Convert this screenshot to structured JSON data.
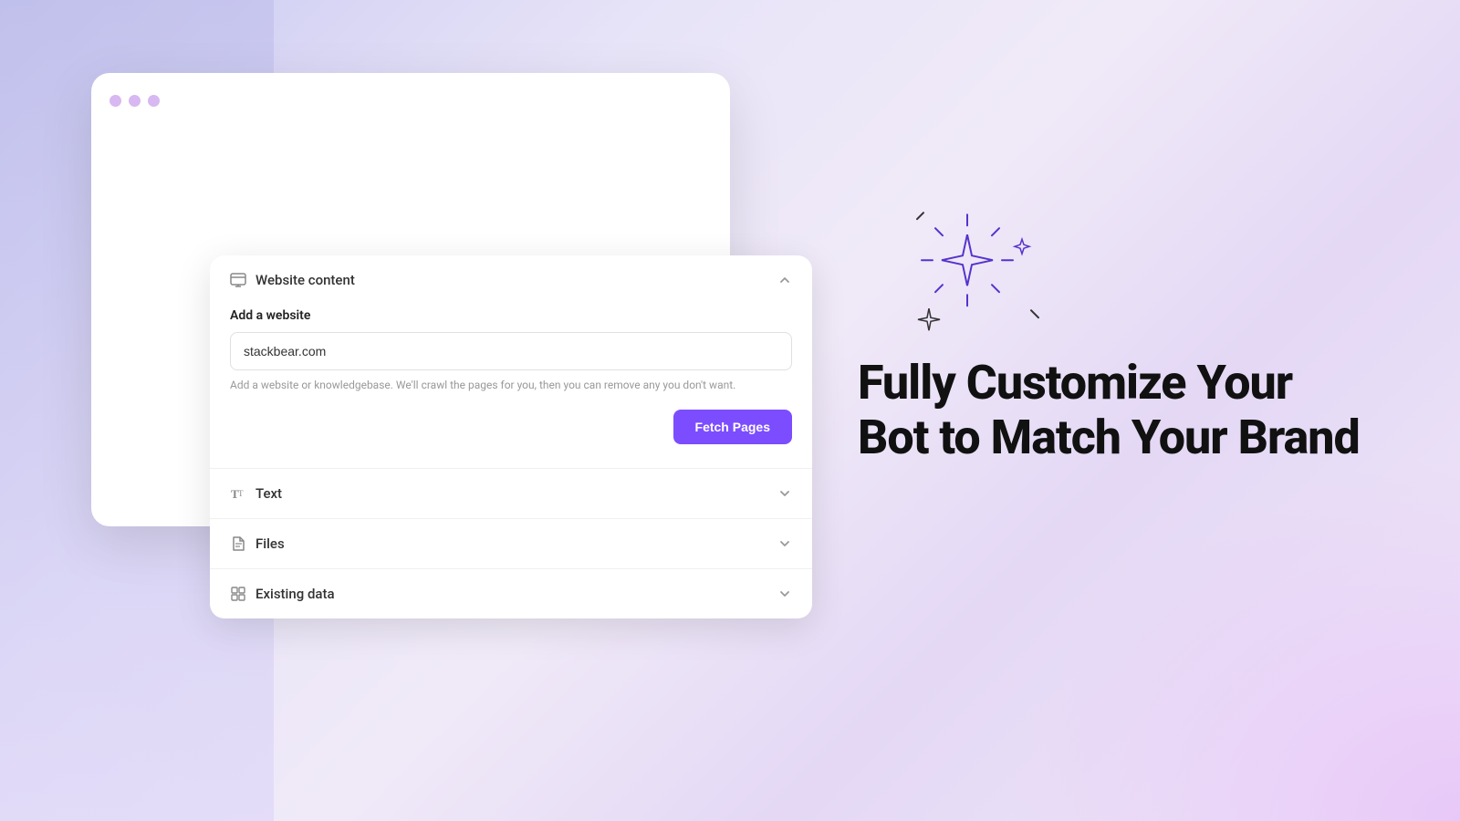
{
  "browser": {
    "dots": [
      "dot1",
      "dot2",
      "dot3"
    ]
  },
  "content_card": {
    "sections": [
      {
        "id": "website-content",
        "icon": "browser-icon",
        "title": "Website content",
        "expanded": true,
        "chevron": "up"
      },
      {
        "id": "text",
        "icon": "text-icon",
        "title": "Text",
        "expanded": false,
        "chevron": "down"
      },
      {
        "id": "files",
        "icon": "file-icon",
        "title": "Files",
        "expanded": false,
        "chevron": "down"
      },
      {
        "id": "existing-data",
        "icon": "grid-icon",
        "title": "Existing data",
        "expanded": false,
        "chevron": "down"
      }
    ],
    "add_website_label": "Add a website",
    "url_value": "stackbear.com",
    "url_placeholder": "stackbear.com",
    "helper_text": "Add a website or knowledgebase. We'll crawl the pages for you, then you can remove any you don't want.",
    "fetch_button_label": "Fetch Pages"
  },
  "right_panel": {
    "headline_line1": "Fully Customize Your",
    "headline_line2": "Bot to Match Your Brand"
  },
  "colors": {
    "accent": "#7c4dff",
    "dot_color": "#c8b8e8"
  }
}
